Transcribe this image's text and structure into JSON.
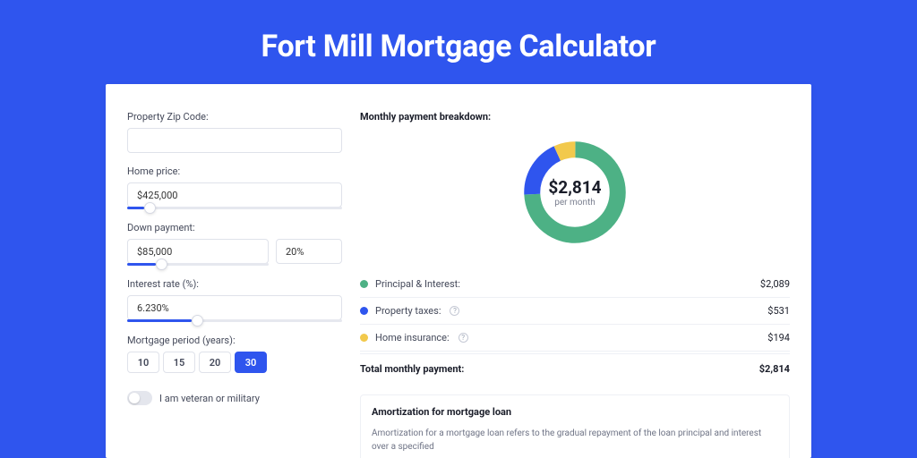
{
  "page": {
    "title": "Fort Mill Mortgage Calculator"
  },
  "form": {
    "zip": {
      "label": "Property Zip Code:",
      "value": ""
    },
    "home_price": {
      "label": "Home price:",
      "value": "$425,000",
      "slider_pct": 8
    },
    "down_payment": {
      "label": "Down payment:",
      "amount": "$85,000",
      "percent": "20%",
      "slider_pct": 20
    },
    "interest_rate": {
      "label": "Interest rate (%):",
      "value": "6.230%",
      "slider_pct": 30
    },
    "mortgage_period": {
      "label": "Mortgage period (years):",
      "options": [
        "10",
        "15",
        "20",
        "30"
      ],
      "selected": "30"
    },
    "veteran": {
      "label": "I am veteran or military",
      "on": false
    }
  },
  "breakdown": {
    "title": "Monthly payment breakdown:",
    "center": {
      "amount": "$2,814",
      "sub": "per month"
    },
    "rows": [
      {
        "color": "#4db185",
        "label": "Principal & Interest:",
        "help": false,
        "value": "$2,089"
      },
      {
        "color": "#2f55ee",
        "label": "Property taxes:",
        "help": true,
        "value": "$531"
      },
      {
        "color": "#f2c94c",
        "label": "Home insurance:",
        "help": true,
        "value": "$194"
      }
    ],
    "total": {
      "label": "Total monthly payment:",
      "value": "$2,814"
    }
  },
  "amortization": {
    "title": "Amortization for mortgage loan",
    "body": "Amortization for a mortgage loan refers to the gradual repayment of the loan principal and interest over a specified"
  },
  "chart_data": {
    "type": "pie",
    "title": "Monthly payment breakdown",
    "series": [
      {
        "name": "Principal & Interest",
        "value": 2089,
        "color": "#4db185"
      },
      {
        "name": "Property taxes",
        "value": 531,
        "color": "#2f55ee"
      },
      {
        "name": "Home insurance",
        "value": 194,
        "color": "#f2c94c"
      }
    ],
    "total": 2814,
    "center_label": "$2,814 per month"
  }
}
